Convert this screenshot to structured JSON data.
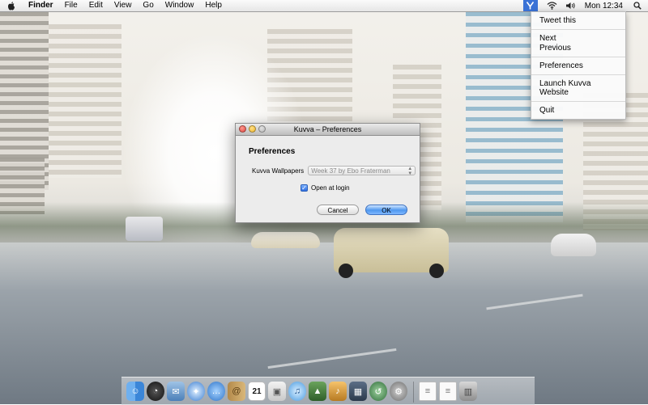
{
  "menubar": {
    "apple_icon": "apple-icon",
    "app_name": "Finder",
    "items": [
      "File",
      "Edit",
      "View",
      "Go",
      "Window",
      "Help"
    ],
    "extras": [
      "kuvva-icon",
      "wifi-icon",
      "volume-icon"
    ],
    "clock": "Mon 12:34",
    "search_icon": "spotlight-icon"
  },
  "status_menu": {
    "items": [
      {
        "label": "Tweet this"
      },
      {
        "label": "Next"
      },
      {
        "label": "Previous"
      },
      {
        "label": "Preferences"
      },
      {
        "label": "Launch Kuvva Website"
      },
      {
        "label": "Quit"
      }
    ]
  },
  "preferences_window": {
    "title": "Kuvva – Preferences",
    "heading": "Preferences",
    "wallpapers_label": "Kuvva Wallpapers",
    "wallpaper_selected": "Week 37 by Ebo Fraterman",
    "open_at_login_label": "Open at login",
    "open_at_login_checked": true,
    "cancel_label": "Cancel",
    "ok_label": "OK"
  },
  "dock": {
    "calendar_date": "21",
    "icons": [
      "finder-icon",
      "dashboard-icon",
      "mail-icon",
      "safari-icon",
      "ichat-icon",
      "address-book-icon",
      "ical-icon",
      "preview-icon",
      "itunes-icon",
      "iphoto-icon",
      "garageband-icon",
      "spaces-icon",
      "time-machine-icon",
      "system-preferences-icon",
      "document-icon",
      "document-icon-2",
      "trash-icon"
    ]
  },
  "colors": {
    "menubar_highlight": "#3a72d6",
    "ok_button": "#4f98ef",
    "close_light": "#e0443e",
    "minimize_light": "#f0b627",
    "zoom_light": "#b8b8b8"
  }
}
